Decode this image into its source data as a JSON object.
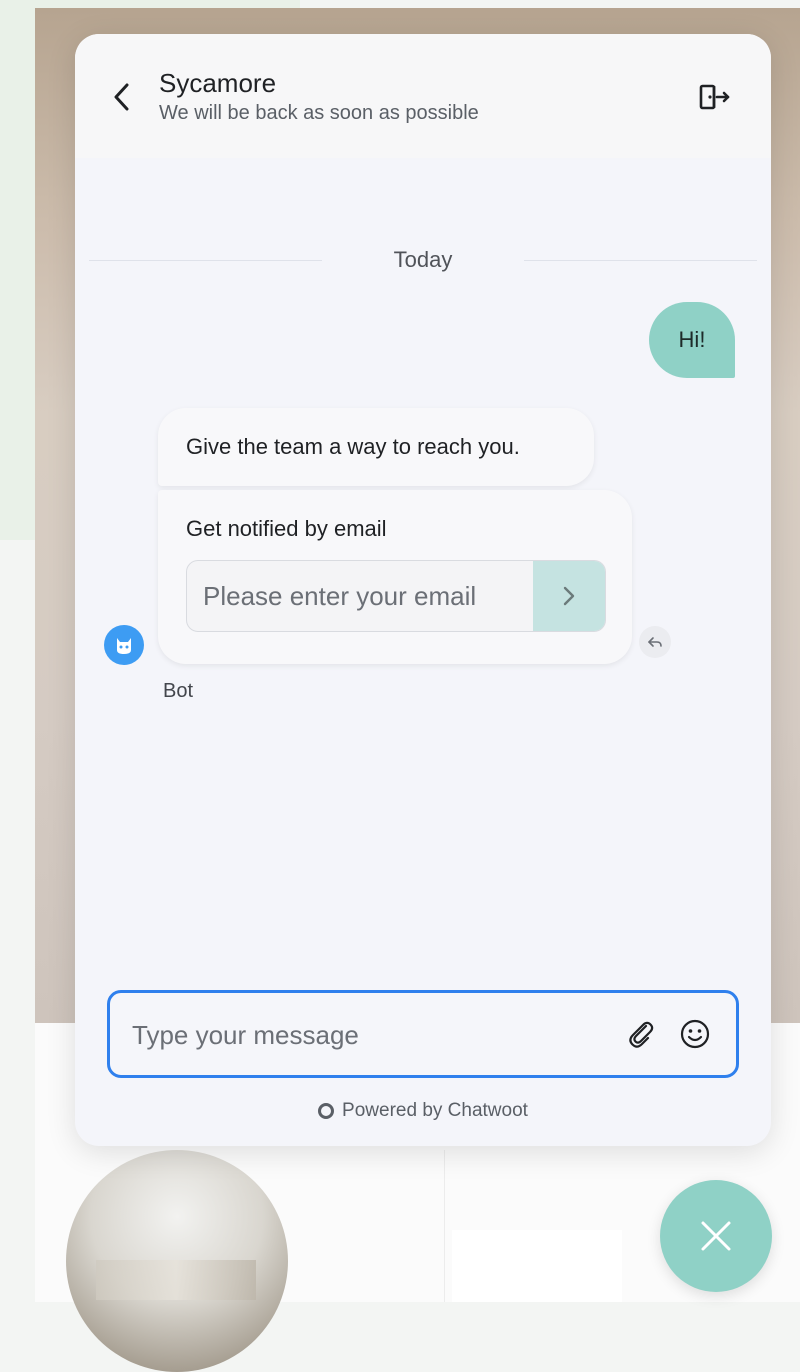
{
  "header": {
    "title": "Sycamore",
    "subtitle": "We will be back as soon as possible"
  },
  "conversation": {
    "date_separator": "Today",
    "messages": [
      {
        "sender": "user",
        "text": "Hi!"
      },
      {
        "sender": "bot",
        "text": "Give the team a way to reach you."
      }
    ],
    "email_form": {
      "label": "Get notified by email",
      "placeholder": "Please enter your email"
    },
    "bot_name": "Bot"
  },
  "composer": {
    "placeholder": "Type your message"
  },
  "footer": {
    "powered_by": "Powered by Chatwoot"
  },
  "icons": {
    "back": "chevron-left-icon",
    "exit": "exit-icon",
    "submit": "chevron-right-icon",
    "reply": "reply-icon",
    "attach": "paperclip-icon",
    "emoji": "smiley-icon",
    "close": "close-icon",
    "bot": "bot-icon"
  },
  "colors": {
    "accent": "#8fd1c6",
    "focus_border": "#2f80ed",
    "bot_avatar": "#3d9cf3",
    "submit_bg": "#c5e3e1"
  }
}
